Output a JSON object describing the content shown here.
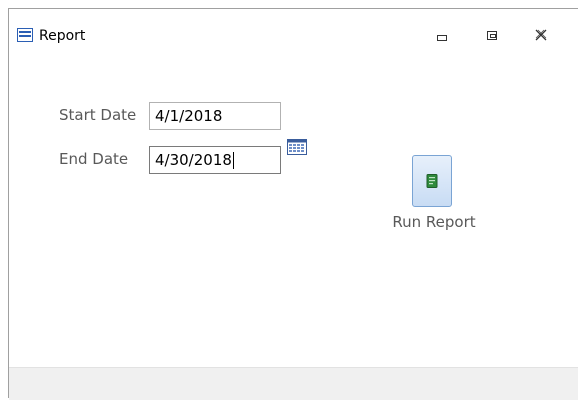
{
  "window": {
    "title": "Report"
  },
  "form": {
    "start_date_label": "Start Date",
    "start_date_value": "4/1/2018",
    "end_date_label": "End Date",
    "end_date_value": "4/30/2018",
    "run_button_label": "Run Report"
  },
  "icons": {
    "app": "form-icon",
    "minimize": "minimize-icon",
    "restore": "restore-icon",
    "close": "close-icon",
    "calendar": "calendar-icon",
    "report": "report-icon"
  },
  "colors": {
    "accent": "#2b5fb4",
    "label": "#595959",
    "button_face": "#c8dcf4",
    "footer": "#f0f0f0"
  }
}
